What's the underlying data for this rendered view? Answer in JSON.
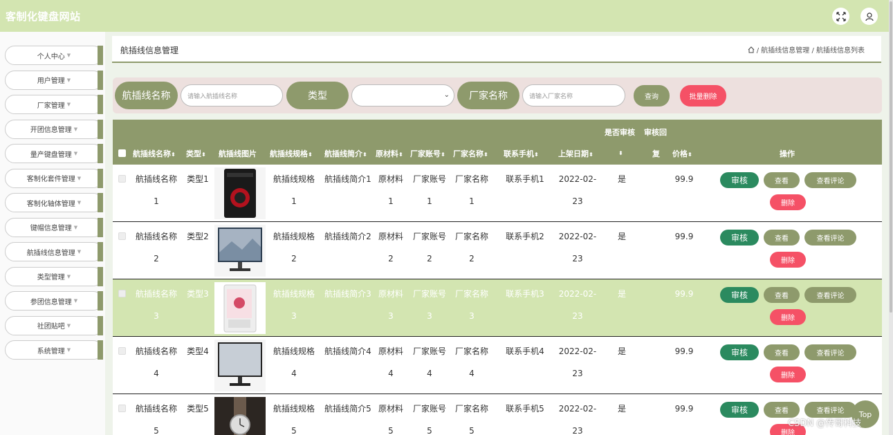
{
  "header": {
    "brand": "客制化键盘网站",
    "fullscreen_icon": "expand-icon",
    "user_icon": "user-icon"
  },
  "sidebar": {
    "items": [
      {
        "label": "个人中心"
      },
      {
        "label": "用户管理"
      },
      {
        "label": "厂家管理"
      },
      {
        "label": "开团信息管理"
      },
      {
        "label": "量产键盘管理"
      },
      {
        "label": "客制化套件管理"
      },
      {
        "label": "客制化轴体管理"
      },
      {
        "label": "键帽信息管理"
      },
      {
        "label": "航插线信息管理"
      },
      {
        "label": "类型管理"
      },
      {
        "label": "参团信息管理"
      },
      {
        "label": "社团贴吧"
      },
      {
        "label": "系统管理"
      }
    ]
  },
  "page": {
    "title": "航插线信息管理",
    "breadcrumb": [
      "航插线信息管理",
      "航插线信息列表"
    ],
    "sep": "/"
  },
  "search": {
    "name_label": "航插线名称",
    "name_placeholder": "请输入航插线名称",
    "type_label": "类型",
    "type_value": "",
    "vendor_label": "厂家名称",
    "vendor_placeholder": "请输入厂家名称",
    "query_label": "查询",
    "batch_delete_label": "批量删除"
  },
  "table": {
    "headers": {
      "name": "航插线名称",
      "type": "类型",
      "image": "航插线图片",
      "spec": "航插线规格",
      "intro": "航插线简介",
      "material": "原材料",
      "vendor_account": "厂家账号",
      "vendor_name": "厂家名称",
      "phone": "联系手机",
      "date": "上架日期",
      "audited_top": "是否审核",
      "reply_top": "审核回",
      "reply_bottom": "复",
      "price": "价格",
      "actions": "操作"
    },
    "actions": {
      "audit": "审核",
      "view": "查看",
      "review": "查看评论",
      "delete": "删除"
    },
    "rows": [
      {
        "name1": "航插线名称",
        "name2": "1",
        "type": "类型1",
        "spec1": "航插线规格",
        "spec2": "1",
        "intro": "航插线简介1",
        "mat1": "原材料",
        "mat2": "1",
        "acc1": "厂家账号",
        "acc2": "1",
        "ven1": "厂家名称",
        "ven2": "1",
        "phone": "联系手机1",
        "date1": "2022-02-",
        "date2": "23",
        "audited": "是",
        "price": "99.9",
        "img": "pc-case-red"
      },
      {
        "name1": "航插线名称",
        "name2": "2",
        "type": "类型2",
        "spec1": "航插线规格",
        "spec2": "2",
        "intro": "航插线简介2",
        "mat1": "原材料",
        "mat2": "2",
        "acc1": "厂家账号",
        "acc2": "2",
        "ven1": "厂家名称",
        "ven2": "2",
        "phone": "联系手机2",
        "date1": "2022-02-",
        "date2": "23",
        "audited": "是",
        "price": "99.9",
        "img": "monitor-landscape"
      },
      {
        "name1": "航插线名称",
        "name2": "3",
        "type": "类型3",
        "spec1": "航插线规格",
        "spec2": "3",
        "intro": "航插线简介3",
        "mat1": "原材料",
        "mat2": "3",
        "acc1": "厂家账号",
        "acc2": "3",
        "ven1": "厂家名称",
        "ven2": "3",
        "phone": "联系手机3",
        "date1": "2022-02-",
        "date2": "23",
        "audited": "是",
        "price": "99.9",
        "img": "pc-case-white"
      },
      {
        "name1": "航插线名称",
        "name2": "4",
        "type": "类型4",
        "spec1": "航插线规格",
        "spec2": "4",
        "intro": "航插线简介4",
        "mat1": "原材料",
        "mat2": "4",
        "acc1": "厂家账号",
        "acc2": "4",
        "ven1": "厂家名称",
        "ven2": "4",
        "phone": "联系手机4",
        "date1": "2022-02-",
        "date2": "23",
        "audited": "是",
        "price": "99.9",
        "img": "monitor-grey"
      },
      {
        "name1": "航插线名称",
        "name2": "5",
        "type": "类型5",
        "spec1": "航插线规格",
        "spec2": "5",
        "intro": "航插线简介5",
        "mat1": "原材料",
        "mat2": "5",
        "acc1": "厂家账号",
        "acc2": "5",
        "ven1": "厂家名称",
        "ven2": "5",
        "phone": "联系手机5",
        "date1": "2022-02-",
        "date2": "23",
        "audited": "是",
        "price": "99.9",
        "img": "wristwatch"
      }
    ]
  },
  "top_button": "Top",
  "watermark": "CSDN @传哥科技",
  "colors": {
    "header": "#d3e5b1",
    "accent": "#8e9a6c",
    "audit": "#2b8a5f",
    "danger": "#f55166",
    "highlight_row": "#d3e5b1"
  }
}
